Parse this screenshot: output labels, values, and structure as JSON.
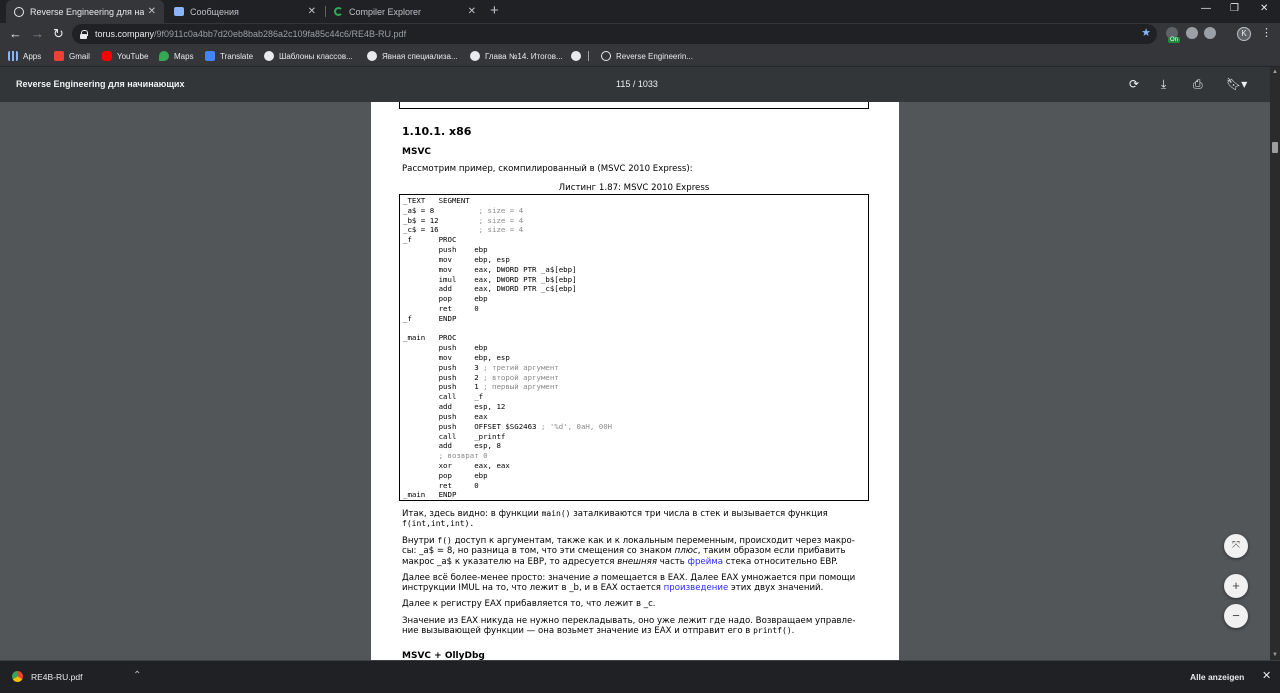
{
  "tabs": [
    {
      "title": "Reverse Engineering для начина",
      "active": true
    },
    {
      "title": "Сообщения",
      "active": false
    },
    {
      "title": "Compiler Explorer",
      "active": false
    }
  ],
  "address": {
    "host": "torus.company",
    "path": "/9f0911c0a4bb7d20eb8bab286a2c109fa85c44c6/RE4B-RU.pdf"
  },
  "ext_badge": "On",
  "avatar_letter": "K",
  "bookmarks": [
    "Apps",
    "Gmail",
    "YouTube",
    "Maps",
    "Translate",
    "Шаблоны классов...",
    "Явная специализа...",
    "Глава №14. Итогов...",
    "",
    "Reverse Engineerin..."
  ],
  "pdf": {
    "title": "Reverse Engineering для начинающих",
    "page_indicator": "115 / 1033"
  },
  "doc": {
    "heading": "1.10.1. x86",
    "subheading": "MSVC",
    "intro": "Рассмотрим пример, скомпилированный в (MSVC 2010 Express):",
    "caption": "Листинг 1.87: MSVC 2010 Express",
    "code": [
      {
        "code": "_TEXT   SEGMENT",
        "comment": ""
      },
      {
        "code": "_a$ = 8          ",
        "comment": "; size = 4"
      },
      {
        "code": "_b$ = 12         ",
        "comment": "; size = 4"
      },
      {
        "code": "_c$ = 16         ",
        "comment": "; size = 4"
      },
      {
        "code": "_f      PROC",
        "comment": ""
      },
      {
        "code": "        push    ebp",
        "comment": ""
      },
      {
        "code": "        mov     ebp, esp",
        "comment": ""
      },
      {
        "code": "        mov     eax, DWORD PTR _a$[ebp]",
        "comment": ""
      },
      {
        "code": "        imul    eax, DWORD PTR _b$[ebp]",
        "comment": ""
      },
      {
        "code": "        add     eax, DWORD PTR _c$[ebp]",
        "comment": ""
      },
      {
        "code": "        pop     ebp",
        "comment": ""
      },
      {
        "code": "        ret     0",
        "comment": ""
      },
      {
        "code": "_f      ENDP",
        "comment": ""
      },
      {
        "code": "",
        "comment": ""
      },
      {
        "code": "_main   PROC",
        "comment": ""
      },
      {
        "code": "        push    ebp",
        "comment": ""
      },
      {
        "code": "        mov     ebp, esp",
        "comment": ""
      },
      {
        "code": "        push    3 ",
        "comment": "; третий аргумент"
      },
      {
        "code": "        push    2 ",
        "comment": "; второй аргумент"
      },
      {
        "code": "        push    1 ",
        "comment": "; первый аргумент"
      },
      {
        "code": "        call    _f",
        "comment": ""
      },
      {
        "code": "        add     esp, 12",
        "comment": ""
      },
      {
        "code": "        push    eax",
        "comment": ""
      },
      {
        "code": "        push    OFFSET $SG2463 ",
        "comment": "; '%d', 0aH, 00H"
      },
      {
        "code": "        call    _printf",
        "comment": ""
      },
      {
        "code": "        add     esp, 8",
        "comment": ""
      },
      {
        "code": "        ",
        "comment": "; возврат 0"
      },
      {
        "code": "        xor     eax, eax",
        "comment": ""
      },
      {
        "code": "        pop     ebp",
        "comment": ""
      },
      {
        "code": "        ret     0",
        "comment": ""
      },
      {
        "code": "_main   ENDP",
        "comment": ""
      }
    ],
    "p1_a": "Итак, здесь видно: в функции ",
    "p1_code1": "main()",
    "p1_b": " заталкиваются три числа в стек и вызывается функция",
    "p1_code2": "f(int,int,int).",
    "p2_a": "Внутри ",
    "p2_code1": "f()",
    "p2_b": " доступ к аргументам, также как и к локальным переменным, происходит через макро-",
    "p2_c": "сы: _a$ = 8, но разница в том, что эти смещения со знаком ",
    "p2_em1": "плюс",
    "p2_d": ", таким образом если прибавить",
    "p2_e": "макрос _a$ к указателю на EBP, то адресуется ",
    "p2_em2": "внешняя",
    "p2_f": " часть ",
    "p2_link": "фрейма",
    "p2_g": " стека относительно EBP.",
    "p3_a": "Далее всё более-менее просто: значение ",
    "p3_var": "a",
    "p3_b": " помещается в EAX. Далее EAX умножается при помощи",
    "p3_c": "инструкции IMUL на то, что лежит в _b, и в EAX остается ",
    "p3_link": "произведение",
    "p3_d": " этих двух значений.",
    "p4": "Далее к регистру EAX прибавляется то, что лежит в _c.",
    "p5_a": "Значение из EAX никуда не нужно перекладывать, оно уже лежит где надо. Возвращаем управле-",
    "p5_b": "ние вызывающей функции — она возьмет значение из EAX и отправит его в ",
    "p5_code": "printf()",
    "p5_c": ".",
    "next_heading": "MSVC + OllyDbg"
  },
  "downloads": {
    "file": "RE4B-RU.pdf",
    "show_all": "Alle anzeigen"
  }
}
